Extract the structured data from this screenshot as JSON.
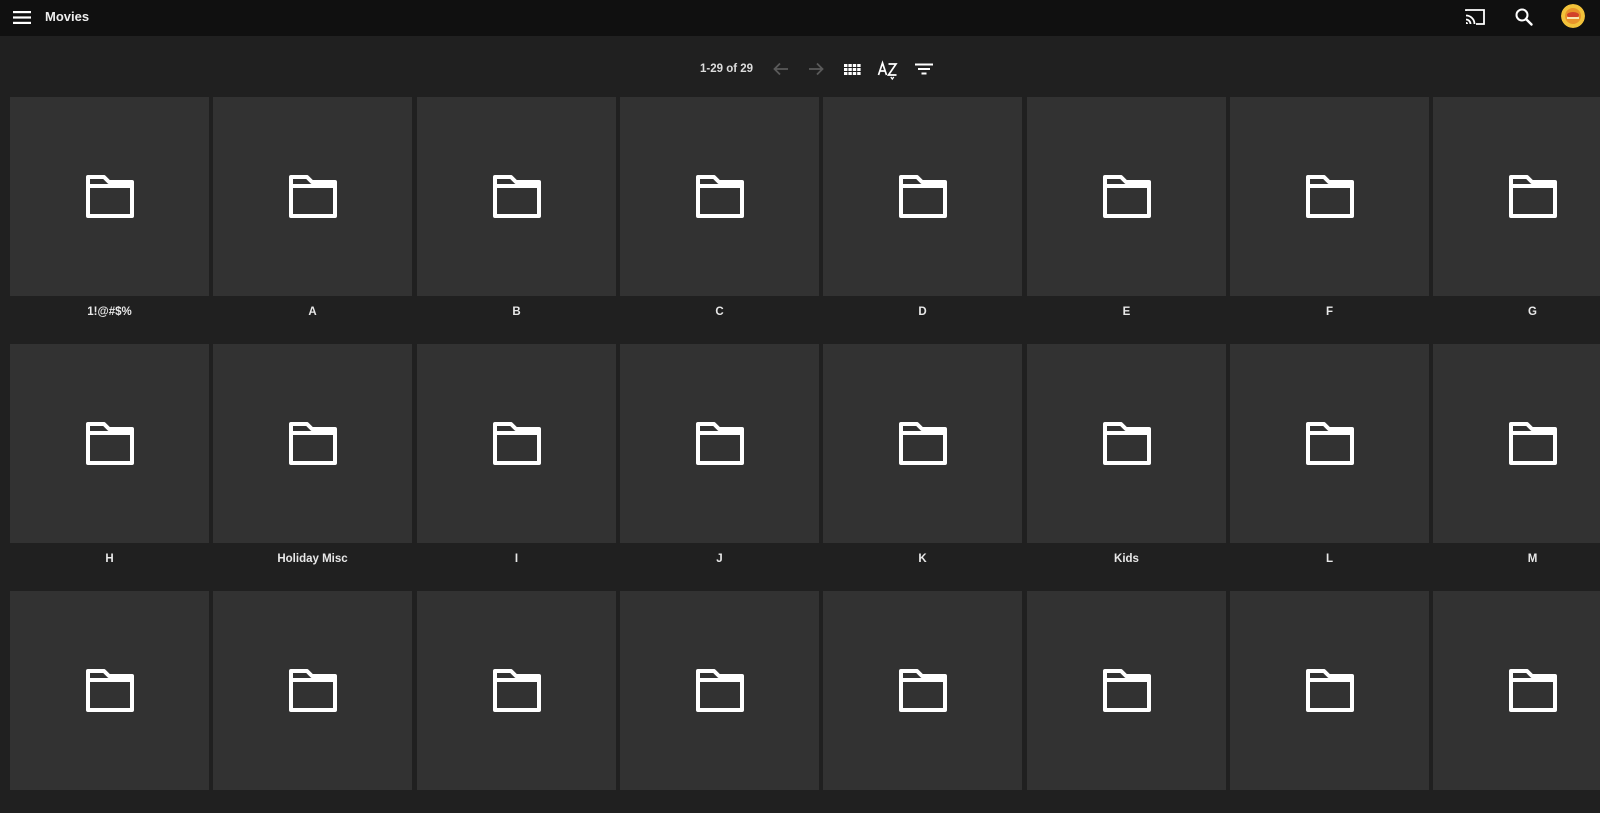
{
  "header": {
    "title": "Movies",
    "menu_icon": "hamburger-menu-icon",
    "cast_icon": "cast-icon",
    "search_icon": "search-icon",
    "avatar_icon": "user-avatar"
  },
  "toolbar": {
    "pager_text": "1-29 of 29",
    "prev_icon": "arrow-left-icon",
    "next_icon": "arrow-right-icon",
    "view_icon": "grid-view-icon",
    "sort_icon": "sort-az-icon",
    "filter_icon": "filter-icon"
  },
  "colors": {
    "background": "#202020",
    "header_bg": "#101010",
    "card_bg": "#323232",
    "text": "#ffffff",
    "disabled": "#5a5a5a"
  },
  "folders": [
    {
      "label": "1!@#$%"
    },
    {
      "label": "A"
    },
    {
      "label": "B"
    },
    {
      "label": "C"
    },
    {
      "label": "D"
    },
    {
      "label": "E"
    },
    {
      "label": "F"
    },
    {
      "label": "G"
    },
    {
      "label": "H"
    },
    {
      "label": "Holiday Misc"
    },
    {
      "label": "I"
    },
    {
      "label": "J"
    },
    {
      "label": "K"
    },
    {
      "label": "Kids"
    },
    {
      "label": "L"
    },
    {
      "label": "M"
    },
    {
      "label": ""
    },
    {
      "label": ""
    },
    {
      "label": ""
    },
    {
      "label": ""
    },
    {
      "label": ""
    },
    {
      "label": ""
    },
    {
      "label": ""
    },
    {
      "label": ""
    }
  ]
}
